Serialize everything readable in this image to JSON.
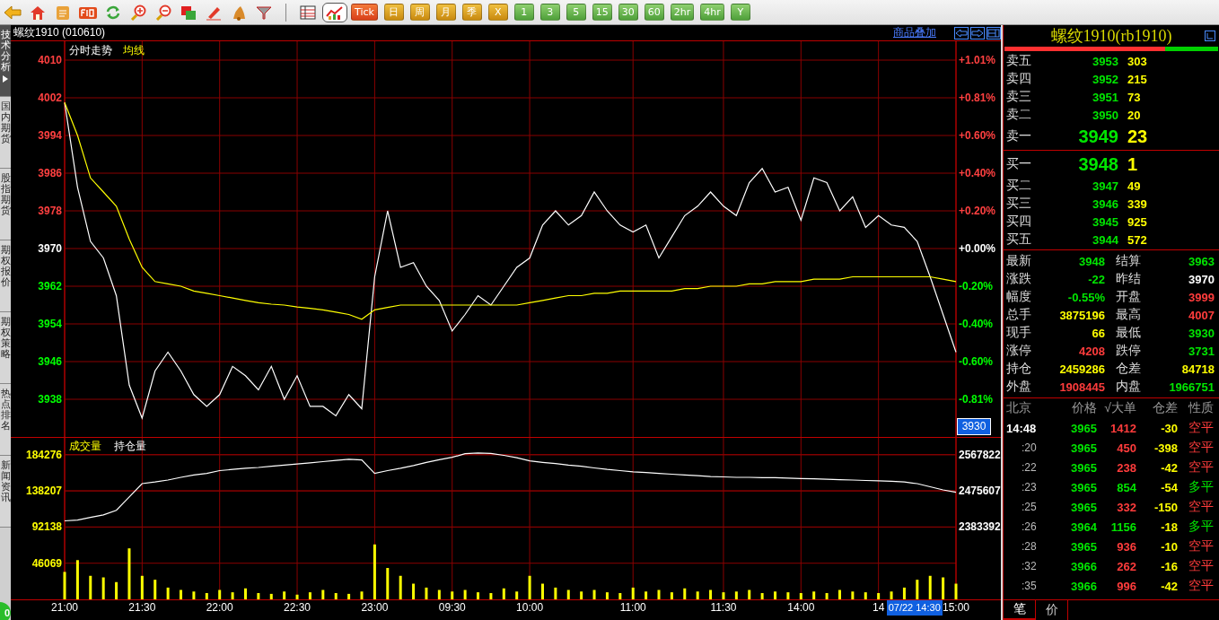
{
  "toolbar": {
    "view_buttons": [
      {
        "selected": false
      },
      {
        "selected": true
      }
    ],
    "period_buttons": [
      {
        "label": "Tick",
        "kind": "tick"
      },
      {
        "label": "日",
        "kind": "calendar"
      },
      {
        "label": "周",
        "kind": "calendar"
      },
      {
        "label": "月",
        "kind": "calendar"
      },
      {
        "label": "季",
        "kind": "calendar"
      },
      {
        "label": "X",
        "kind": "calendar"
      },
      {
        "label": "1",
        "kind": "interval"
      },
      {
        "label": "3",
        "kind": "interval"
      },
      {
        "label": "5",
        "kind": "interval"
      },
      {
        "label": "15",
        "kind": "interval"
      },
      {
        "label": "30",
        "kind": "interval"
      },
      {
        "label": "60",
        "kind": "interval"
      },
      {
        "label": "2hr",
        "kind": "interval"
      },
      {
        "label": "4hr",
        "kind": "interval"
      },
      {
        "label": "Y",
        "kind": "interval"
      }
    ]
  },
  "side_tabs": [
    {
      "label": "技术分析",
      "selected": true
    },
    {
      "label": "国内期货",
      "selected": false
    },
    {
      "label": "股指期货",
      "selected": false
    },
    {
      "label": "期权报价",
      "selected": false
    },
    {
      "label": "期权策略",
      "selected": false
    },
    {
      "label": "热点排名",
      "selected": false
    },
    {
      "label": "新闻资讯",
      "selected": false
    }
  ],
  "status_badge": "0",
  "chart_title": "螺纹1910 (010610)",
  "overlay_link": "商品叠加",
  "price_panel": {
    "right_axis_labels": [
      {
        "label": "+1.01%",
        "color": "#ff4040"
      },
      {
        "label": "+0.81%",
        "color": "#ff4040"
      },
      {
        "label": "+0.60%",
        "color": "#ff4040"
      },
      {
        "label": "+0.40%",
        "color": "#ff4040"
      },
      {
        "label": "+0.20%",
        "color": "#ff4040"
      },
      {
        "label": "+0.00%",
        "color": "#ffffff"
      },
      {
        "label": "-0.20%",
        "color": "#00ff00"
      },
      {
        "label": "-0.40%",
        "color": "#00ff00"
      },
      {
        "label": "-0.60%",
        "color": "#00ff00"
      },
      {
        "label": "-0.81%",
        "color": "#00ff00"
      }
    ],
    "chart_data": {
      "type": "line",
      "ylim": [
        3930,
        4014
      ],
      "grid": true,
      "series": [
        {
          "name": "分时走势",
          "color": "#ffffff",
          "values": [
            4001,
            3983,
            3971.5,
            3968,
            3960,
            3941,
            3934,
            3944,
            3948,
            3944,
            3939,
            3936.5,
            3939,
            3945,
            3943,
            3940,
            3945,
            3938,
            3943,
            3936.5,
            3936.5,
            3934.5,
            3939,
            3936,
            3964,
            3978,
            3966,
            3967,
            3962,
            3959,
            3952.5,
            3956,
            3960,
            3958,
            3962,
            3966,
            3968,
            3975,
            3978,
            3975,
            3977,
            3982,
            3978,
            3975,
            3973.5,
            3975,
            3968,
            3972.5,
            3977,
            3979,
            3982,
            3979,
            3977,
            3984,
            3987,
            3982,
            3983,
            3976,
            3985,
            3984,
            3978,
            3981,
            3974.5,
            3977,
            3975,
            3974.5,
            3971.5,
            3964,
            3956,
            3948
          ]
        },
        {
          "name": "均线",
          "color": "#ffff00",
          "values": [
            4001,
            3994,
            3985,
            3982,
            3979,
            3972,
            3966,
            3963,
            3962.5,
            3962,
            3961,
            3960.5,
            3960,
            3959.5,
            3959,
            3958.5,
            3958.2,
            3958,
            3957.6,
            3957.3,
            3957,
            3956.5,
            3956,
            3955,
            3957,
            3957.5,
            3958,
            3958,
            3958,
            3958,
            3958,
            3958,
            3958,
            3958,
            3958,
            3958,
            3958.5,
            3959,
            3959.5,
            3960,
            3960,
            3960.5,
            3960.5,
            3961,
            3961,
            3961,
            3961,
            3961,
            3961.5,
            3961.5,
            3962,
            3962,
            3962,
            3962.5,
            3962.5,
            3963,
            3963,
            3963,
            3963.5,
            3963.5,
            3963.5,
            3964,
            3964,
            3964,
            3964,
            3964,
            3964,
            3964,
            3963.5,
            3963
          ]
        }
      ],
      "yticks": [
        {
          "value": 4010,
          "label": "4010"
        },
        {
          "value": 4002,
          "label": "4002"
        },
        {
          "value": 3994,
          "label": "3994"
        },
        {
          "value": 3986,
          "label": "3986"
        },
        {
          "value": 3978,
          "label": "3978"
        },
        {
          "value": 3970,
          "label": "3970"
        },
        {
          "value": 3962,
          "label": "3962"
        },
        {
          "value": 3954,
          "label": "3954"
        },
        {
          "value": 3946,
          "label": "3946"
        },
        {
          "value": 3938,
          "label": "3938"
        }
      ]
    }
  },
  "cursor": {
    "price_label": "3930",
    "time_label": "07/22 14:30"
  },
  "volume_panel": {
    "volume_chart": {
      "chart_data": {
        "type": "bar",
        "ylim": [
          0,
          207000
        ],
        "grid": true,
        "categories": [
          "21:00",
          null,
          null,
          null,
          null,
          null,
          "21:30",
          null,
          null,
          null,
          null,
          null,
          "22:00",
          null,
          null,
          null,
          null,
          null,
          "22:30",
          null,
          null,
          null,
          null,
          null,
          "23:00",
          null,
          null,
          null,
          null,
          null,
          "09:30",
          null,
          null,
          null,
          null,
          null,
          "10:00",
          null,
          null,
          null,
          null,
          null,
          null,
          null,
          "11:00",
          null,
          null,
          null,
          null,
          null,
          null,
          "11:30",
          null,
          null,
          null,
          null,
          null,
          "14:00",
          null,
          null,
          null,
          null,
          null,
          "14",
          null,
          null,
          null,
          null,
          null,
          "15:00"
        ],
        "series": [
          {
            "name": "成交量",
            "color": "#ffff00",
            "values": [
              35000,
              50000,
              30000,
              28000,
              22000,
              65000,
              30000,
              25000,
              15000,
              12000,
              10000,
              8000,
              12000,
              9000,
              14000,
              8000,
              7000,
              10000,
              6000,
              9000,
              12000,
              8000,
              7000,
              10000,
              70000,
              40000,
              30000,
              20000,
              15000,
              12000,
              10000,
              12000,
              9000,
              8000,
              14000,
              10000,
              30000,
              20000,
              15000,
              12000,
              10000,
              12000,
              9000,
              8000,
              15000,
              10000,
              12000,
              9000,
              14000,
              10000,
              12000,
              9000,
              10000,
              12000,
              8000,
              10000,
              9000,
              8000,
              10000,
              8000,
              12000,
              10000,
              9000,
              8000,
              10000,
              15000,
              25000,
              30000,
              28000,
              20000
            ]
          }
        ],
        "yticks": [
          {
            "value": 184276,
            "label": "184276"
          },
          {
            "value": 138207,
            "label": "138207"
          },
          {
            "value": 92138,
            "label": "92138"
          },
          {
            "value": 46069,
            "label": "46069"
          }
        ]
      }
    },
    "open_interest_chart": {
      "chart_data": {
        "type": "line",
        "ylim": [
          2198939,
          2612800
        ],
        "grid": true,
        "series": [
          {
            "name": "持仓量",
            "color": "#ffffff",
            "values": [
              2399000,
              2401000,
              2408000,
              2414000,
              2426000,
              2460000,
              2494000,
              2498000,
              2503000,
              2510000,
              2516000,
              2520000,
              2527000,
              2530000,
              2533000,
              2535000,
              2538000,
              2541000,
              2544000,
              2547000,
              2550000,
              2553000,
              2556000,
              2554000,
              2520000,
              2527000,
              2533000,
              2540000,
              2548000,
              2555000,
              2561000,
              2570000,
              2572000,
              2571000,
              2566000,
              2560000,
              2552000,
              2548000,
              2545000,
              2541000,
              2538000,
              2534000,
              2530000,
              2527000,
              2524000,
              2522000,
              2520000,
              2518000,
              2516000,
              2514000,
              2512000,
              2511000,
              2510000,
              2510000,
              2509000,
              2509000,
              2508000,
              2507000,
              2506000,
              2505000,
              2504000,
              2503000,
              2502000,
              2501000,
              2500000,
              2498000,
              2494000,
              2486000,
              2478000,
              2472000
            ]
          }
        ],
        "yticks": [
          {
            "value": 2567822,
            "label": "2567822"
          },
          {
            "value": 2475607,
            "label": "2475607"
          },
          {
            "value": 2383392,
            "label": "2383392"
          }
        ]
      }
    }
  },
  "quote": {
    "title": "螺纹1910(rb1910)",
    "ratio_bar": {
      "level": 0.75
    },
    "asks": [
      {
        "label": "卖五",
        "price": "3953",
        "volume": "303",
        "best": false
      },
      {
        "label": "卖四",
        "price": "3952",
        "volume": "215",
        "best": false
      },
      {
        "label": "卖三",
        "price": "3951",
        "volume": "73",
        "best": false
      },
      {
        "label": "卖二",
        "price": "3950",
        "volume": "20",
        "best": false
      },
      {
        "label": "卖一",
        "price": "3949",
        "volume": "23",
        "best": true
      }
    ],
    "bids": [
      {
        "label": "买一",
        "price": "3948",
        "volume": "1",
        "best": true
      },
      {
        "label": "买二",
        "price": "3947",
        "volume": "49",
        "best": false
      },
      {
        "label": "买三",
        "price": "3946",
        "volume": "339",
        "best": false
      },
      {
        "label": "买四",
        "price": "3945",
        "volume": "925",
        "best": false
      },
      {
        "label": "买五",
        "price": "3944",
        "volume": "572",
        "best": false
      }
    ],
    "stats": [
      {
        "label": "最新",
        "value": "3948",
        "color": "#00e600"
      },
      {
        "label": "结算",
        "value": "3963",
        "color": "#00e600"
      },
      {
        "label": "涨跌",
        "value": "-22",
        "color": "#00e600"
      },
      {
        "label": "昨结",
        "value": "3970",
        "color": "#ffffff"
      },
      {
        "label": "幅度",
        "value": "-0.55%",
        "color": "#00e600"
      },
      {
        "label": "开盘",
        "value": "3999",
        "color": "#ff3c3c"
      },
      {
        "label": "总手",
        "value": "3875196",
        "color": "#ffff00"
      },
      {
        "label": "最高",
        "value": "4007",
        "color": "#ff3c3c"
      },
      {
        "label": "现手",
        "value": "66",
        "color": "#ffff00"
      },
      {
        "label": "最低",
        "value": "3930",
        "color": "#00e600"
      },
      {
        "label": "涨停",
        "value": "4208",
        "color": "#ff3c3c"
      },
      {
        "label": "跌停",
        "value": "3731",
        "color": "#00e600"
      },
      {
        "label": "持仓",
        "value": "2459286",
        "color": "#ffff00"
      },
      {
        "label": "仓差",
        "value": "84718",
        "color": "#ffff00"
      },
      {
        "label": "外盘",
        "value": "1908445",
        "color": "#ff3c3c"
      },
      {
        "label": "内盘",
        "value": "1966751",
        "color": "#00e600"
      }
    ]
  },
  "ticks": {
    "columns": [
      "北京",
      "价格",
      "√大单",
      "仓差",
      "性质"
    ],
    "rows": [
      {
        "time": "14:48",
        "price": "3965",
        "volume": "1412",
        "oi_change": "-30",
        "type": "空平",
        "color": "#ff3c3c"
      },
      {
        "time": ":20",
        "price": "3965",
        "volume": "450",
        "oi_change": "-398",
        "type": "空平",
        "color": "#ff3c3c"
      },
      {
        "time": ":22",
        "price": "3965",
        "volume": "238",
        "oi_change": "-42",
        "type": "空平",
        "color": "#ff3c3c"
      },
      {
        "time": ":23",
        "price": "3965",
        "volume": "854",
        "oi_change": "-54",
        "type": "多平",
        "color": "#00e600"
      },
      {
        "time": ":25",
        "price": "3965",
        "volume": "332",
        "oi_change": "-150",
        "type": "空平",
        "color": "#ff3c3c"
      },
      {
        "time": ":26",
        "price": "3964",
        "volume": "1156",
        "oi_change": "-18",
        "type": "多平",
        "color": "#00e600"
      },
      {
        "time": ":28",
        "price": "3965",
        "volume": "936",
        "oi_change": "-10",
        "type": "空平",
        "color": "#ff3c3c"
      },
      {
        "time": ":32",
        "price": "3966",
        "volume": "262",
        "oi_change": "-16",
        "type": "空平",
        "color": "#ff3c3c"
      },
      {
        "time": ":35",
        "price": "3966",
        "volume": "996",
        "oi_change": "-42",
        "type": "空平",
        "color": "#ff3c3c"
      }
    ],
    "tabs": [
      {
        "label": "笔",
        "selected": true
      },
      {
        "label": "价",
        "selected": false
      }
    ]
  }
}
